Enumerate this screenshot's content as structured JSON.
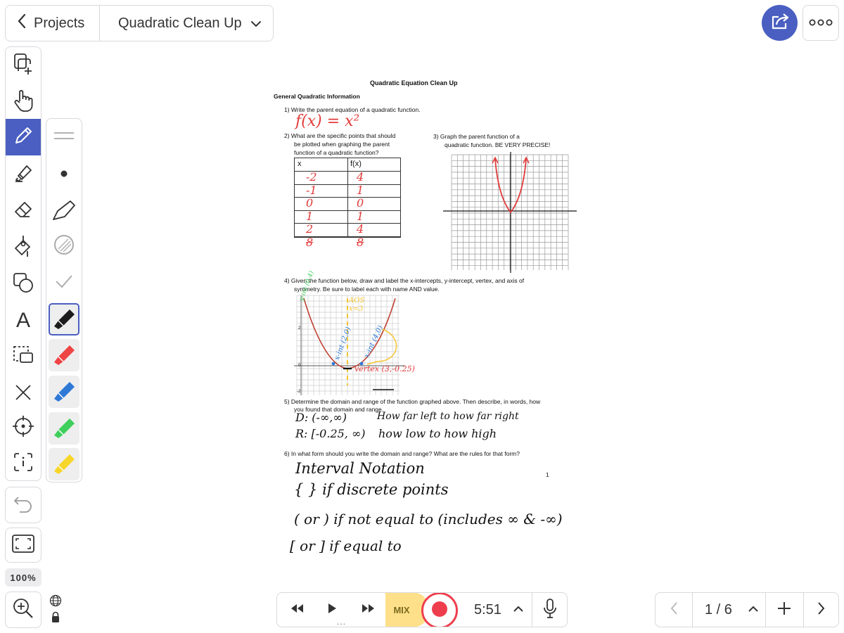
{
  "header": {
    "back_label": "Projects",
    "title": "Quadratic Clean Up"
  },
  "icons": {
    "back": "chevron-left-icon",
    "title_dropdown": "chevron-down-icon",
    "share": "share-icon",
    "more": "more-icon"
  },
  "tools": [
    {
      "name": "add-page",
      "icon": "add-page-icon"
    },
    {
      "name": "hand",
      "icon": "hand-icon"
    },
    {
      "name": "pen",
      "icon": "pen-icon",
      "active": true
    },
    {
      "name": "highlighter",
      "icon": "highlighter-icon"
    },
    {
      "name": "eraser",
      "icon": "eraser-icon"
    },
    {
      "name": "fill",
      "icon": "fill-bucket-icon"
    },
    {
      "name": "shapes",
      "icon": "shapes-icon"
    },
    {
      "name": "text",
      "icon": "text-icon",
      "glyph": "A"
    },
    {
      "name": "select",
      "icon": "lasso-select-icon"
    },
    {
      "name": "clear",
      "icon": "close-icon"
    },
    {
      "name": "laser",
      "icon": "laser-pointer-icon"
    },
    {
      "name": "info",
      "icon": "info-icon"
    }
  ],
  "pen_colors": [
    "#1c1c1c",
    "#ee4444",
    "#2e79d6",
    "#3fcf5c",
    "#f7d62b"
  ],
  "accent_color": "#4a5fc1",
  "zoom": {
    "level": "100%"
  },
  "player": {
    "mix_label": "MIX",
    "time": "5:51",
    "dots": "..."
  },
  "pager": {
    "page_text": "1 / 6"
  },
  "document": {
    "title": "Quadratic Equation Clean Up",
    "section": "General Quadratic Information",
    "q1": "1)   Write the parent equation of a quadratic function.",
    "q1_answer": "f(x) = x²",
    "q2_lines": [
      "2)   What are the specific points that should",
      "be plotted when graphing the parent",
      "function of a quadratic function?"
    ],
    "q3_lines": [
      "3)   Graph the parent function of a",
      "quadratic function.  BE VERY PRECISE!"
    ],
    "table": {
      "headers": [
        "x",
        "f(x)"
      ],
      "rows": [
        [
          "-2",
          "4"
        ],
        [
          "-1",
          "1"
        ],
        [
          "0",
          "0"
        ],
        [
          "1",
          "1"
        ],
        [
          "2",
          "4"
        ],
        [
          "8",
          "8"
        ]
      ]
    },
    "q4_lines": [
      "4)   Given the function below, draw and label the x-intercepts, y-intercept, vertex, and axis of",
      "symmetry.  Be sure to label each with name AND value."
    ],
    "q4_labels": {
      "y_int": "y-int (0,4)",
      "aos": "AOS x=3",
      "x_int1": "x-int (2,0)",
      "x_int2": "x-int (4,0)",
      "vertex": "vertex (3,-0.25)"
    },
    "q4_ticks": [
      "2",
      "0",
      "-2",
      "0",
      "2",
      "4",
      "6"
    ],
    "q5_lines": [
      "5)   Determine the domain and range of the function graphed above.  Then describe, in words, how",
      "you found that domain and range."
    ],
    "q5_d": "D: (-∞,∞)",
    "q5_d_note": "How far left to how far right",
    "q5_r": "R: [-0.25, ∞)",
    "q5_r_note": "how low to how high",
    "q6": "6)   In what form should you write the domain and range?  What are the rules for that form?",
    "page_number": "1",
    "q6_answers": [
      "Interval Notation",
      "{ }  if discrete points",
      "( or )  if not equal to (includes ∞ & -∞)",
      "[ or ]  if equal to"
    ]
  }
}
